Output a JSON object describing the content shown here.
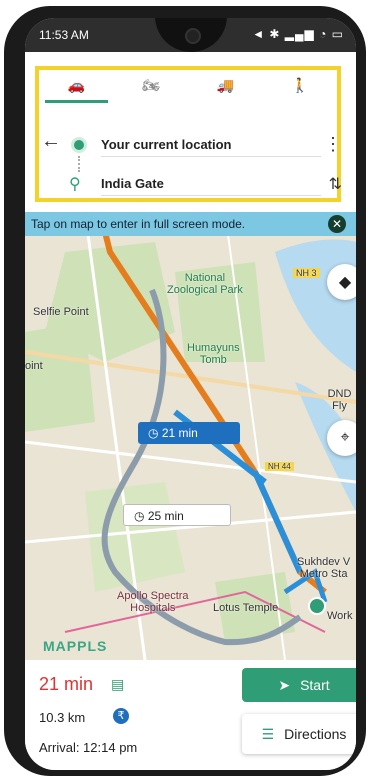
{
  "statusbar": {
    "time": "11:53 AM",
    "icons": "◄ ✱ ▂▄▆ ◔ ▭"
  },
  "route": {
    "modes": [
      {
        "name": "car",
        "icon": "🚗"
      },
      {
        "name": "bike",
        "icon": "🏍"
      },
      {
        "name": "truck",
        "icon": "🚚"
      },
      {
        "name": "walk",
        "icon": "🚶"
      }
    ],
    "from": "Your current location",
    "to": "India Gate"
  },
  "map": {
    "tip": "Tap on map to enter in full screen mode.",
    "labels": {
      "national_zoo": "National\nZoological Park",
      "selfie_point": "Selfie Point",
      "humayuns_tomb": "Humayuns\nTomb",
      "apollo": "Apollo Spectra\nHospitals",
      "lotus_temple": "Lotus Temple",
      "sukhdev": "Sukhdev V\nMetro Sta",
      "work": "Work",
      "point": "oint",
      "dnd": "DND Fly",
      "nh3": "NH 3",
      "nh44": "NH 44"
    },
    "primary_time": "21 min",
    "alt_time": "25 min",
    "brand": "MAPPLS"
  },
  "summary": {
    "eta": "21 min",
    "distance": "10.3 km",
    "arrival": "Arrival: 12:14 pm",
    "start": "Start",
    "directions": "Directions"
  }
}
